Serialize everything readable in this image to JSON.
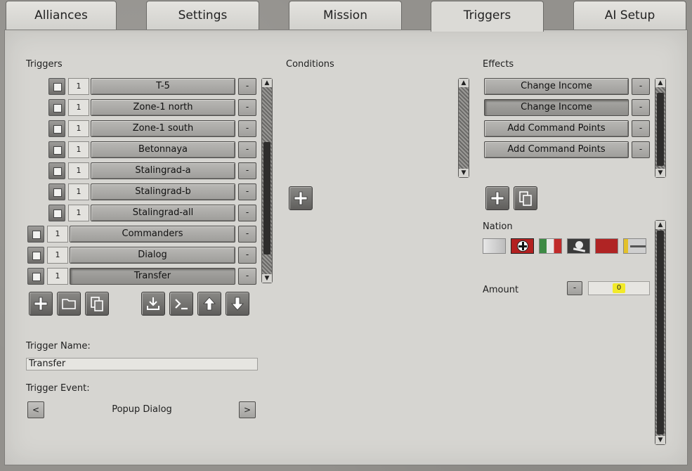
{
  "tabs": [
    "Alliances",
    "Settings",
    "Mission",
    "Triggers",
    "AI Setup"
  ],
  "active_tab": "Triggers",
  "triggers": {
    "heading": "Triggers",
    "items": [
      {
        "num": "1",
        "name": "T-5"
      },
      {
        "num": "1",
        "name": "Zone-1 north"
      },
      {
        "num": "1",
        "name": "Zone-1 south"
      },
      {
        "num": "1",
        "name": "Betonnaya"
      },
      {
        "num": "1",
        "name": "Stalingrad-a"
      },
      {
        "num": "1",
        "name": "Stalingrad-b"
      },
      {
        "num": "1",
        "name": "Stalingrad-all"
      },
      {
        "num": "1",
        "name": "Commanders"
      },
      {
        "num": "1",
        "name": "Dialog"
      },
      {
        "num": "1",
        "name": "Transfer"
      }
    ],
    "remove_label": "-",
    "selected": "Transfer"
  },
  "conditions": {
    "heading": "Conditions"
  },
  "effects": {
    "heading": "Effects",
    "items": [
      "Change Income",
      "Change Income",
      "Add Command Points",
      "Add Command Points"
    ],
    "remove_label": "-"
  },
  "trigger_name": {
    "label": "Trigger Name:",
    "value": "Transfer"
  },
  "trigger_event": {
    "label": "Trigger Event:",
    "value": "Popup Dialog",
    "prev": "<",
    "next": ">"
  },
  "nation": {
    "label": "Nation",
    "flags": [
      "neutral",
      "germany",
      "italy",
      "skull",
      "soviet",
      "finland"
    ]
  },
  "amount": {
    "label": "Amount",
    "minus": "-",
    "value": "0"
  },
  "colors": {
    "panel": "#d6d5d1",
    "button": "#a9a8a5",
    "highlight": "#f2ea2a"
  }
}
